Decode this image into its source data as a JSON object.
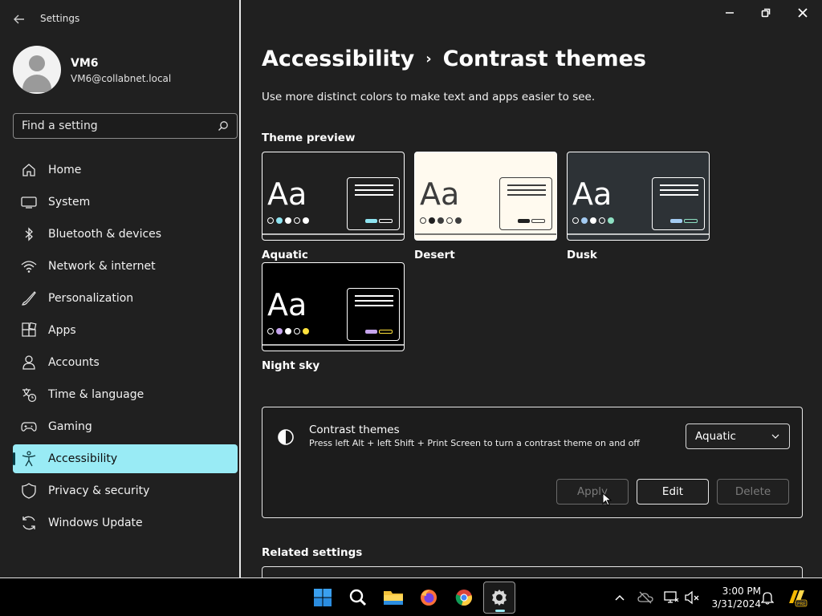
{
  "app": {
    "title": "Settings"
  },
  "user": {
    "name": "VM6",
    "email": "VM6@collabnet.local"
  },
  "search": {
    "placeholder": "Find a setting"
  },
  "nav": [
    {
      "label": "Home",
      "icon": "home-icon"
    },
    {
      "label": "System",
      "icon": "laptop-icon"
    },
    {
      "label": "Bluetooth & devices",
      "icon": "bluetooth-icon"
    },
    {
      "label": "Network & internet",
      "icon": "wifi-icon"
    },
    {
      "label": "Personalization",
      "icon": "brush-icon"
    },
    {
      "label": "Apps",
      "icon": "apps-icon"
    },
    {
      "label": "Accounts",
      "icon": "person-icon"
    },
    {
      "label": "Time & language",
      "icon": "globe-clock-icon"
    },
    {
      "label": "Gaming",
      "icon": "gamepad-icon"
    },
    {
      "label": "Accessibility",
      "icon": "accessibility-icon",
      "active": true
    },
    {
      "label": "Privacy & security",
      "icon": "shield-icon"
    },
    {
      "label": "Windows Update",
      "icon": "update-icon"
    }
  ],
  "main": {
    "breadcrumb_parent": "Accessibility",
    "breadcrumb_separator": "›",
    "page_title": "Contrast themes",
    "subtitle": "Use more distinct colors to make text and apps easier to see.",
    "theme_preview_label": "Theme preview",
    "themes": [
      {
        "name": "Aquatic",
        "sample": "Aa",
        "bg": "#202020",
        "fg": "#ffffff",
        "accent": "#8ee3f0",
        "secondary": "#ffffff"
      },
      {
        "name": "Desert",
        "sample": "Aa",
        "bg": "#fffaef",
        "fg": "#3d3d3d",
        "accent": "#202020",
        "secondary": "#3d3d3d"
      },
      {
        "name": "Dusk",
        "sample": "Aa",
        "bg": "#2d3236",
        "fg": "#ffffff",
        "accent": "#a3cbf2",
        "secondary": "#8ee0c3"
      },
      {
        "name": "Night sky",
        "sample": "Aa",
        "bg": "#000000",
        "fg": "#ffffff",
        "accent": "#c5a4ec",
        "secondary": "#ffe23c"
      }
    ],
    "contrast_panel": {
      "title": "Contrast themes",
      "description": "Press left Alt + left Shift + Print Screen to turn a contrast theme on and off",
      "selected_theme": "Aquatic",
      "apply_label": "Apply",
      "edit_label": "Edit",
      "delete_label": "Delete"
    },
    "related_settings_label": "Related settings"
  },
  "taskbar": {
    "apps": [
      "start-icon",
      "search-icon",
      "file-explorer-icon",
      "firefox-icon",
      "chrome-icon",
      "settings-icon"
    ],
    "time": "3:00 PM",
    "date": "3/31/2024"
  },
  "colors": {
    "accent": "#99ebf5",
    "background": "#202020",
    "taskbar": "#000000"
  }
}
